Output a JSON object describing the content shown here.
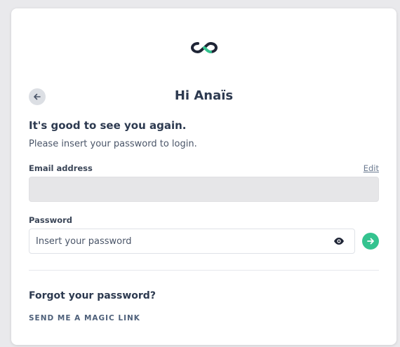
{
  "brand": {
    "logo_icon": "infinity-cc-logo-icon",
    "accent_color": "#34c38f",
    "dark_color": "#1f2536"
  },
  "header": {
    "back_icon": "arrow-left-icon",
    "title": "Hi Anaïs"
  },
  "intro": {
    "heading": "It's good to see you again.",
    "description": "Please insert your password to login."
  },
  "email": {
    "label": "Email address",
    "edit_label": "Edit",
    "value": ""
  },
  "password": {
    "label": "Password",
    "placeholder": "Insert your password",
    "value": "",
    "toggle_icon": "eye-icon",
    "submit_icon": "arrow-right-icon"
  },
  "forgot": {
    "heading": "Forgot your password?",
    "magic_link_label": "SEND ME A MAGIC LINK"
  }
}
